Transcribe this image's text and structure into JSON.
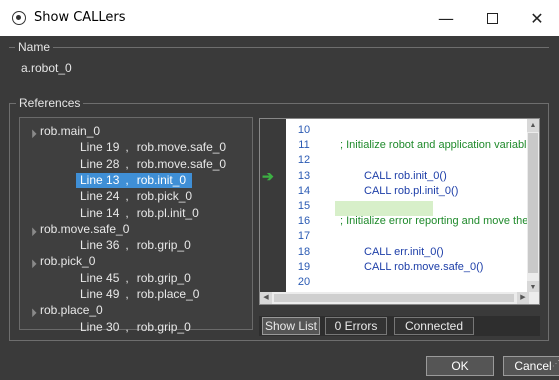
{
  "window": {
    "title": "Show CALLers",
    "minimize_label": "—",
    "close_label": "✕"
  },
  "name_group": {
    "label": "Name",
    "value": "a.robot_0"
  },
  "references": {
    "label": "References",
    "tree": [
      {
        "label": "rob.main_0",
        "children": [
          {
            "line": "Line 19",
            "target": "rob.move.safe_0",
            "selected": false
          },
          {
            "line": "Line 28",
            "target": "rob.move.safe_0",
            "selected": false
          },
          {
            "line": "Line 13",
            "target": "rob.init_0",
            "selected": true
          },
          {
            "line": "Line 24",
            "target": "rob.pick_0",
            "selected": false
          },
          {
            "line": "Line 14",
            "target": "rob.pl.init_0",
            "selected": false
          }
        ]
      },
      {
        "label": "rob.move.safe_0",
        "children": [
          {
            "line": "Line 36",
            "target": "rob.grip_0",
            "selected": false
          }
        ]
      },
      {
        "label": "rob.pick_0",
        "children": [
          {
            "line": "Line 45",
            "target": "rob.grip_0",
            "selected": false
          },
          {
            "line": "Line 49",
            "target": "rob.place_0",
            "selected": false
          }
        ]
      },
      {
        "label": "rob.place_0",
        "children": [
          {
            "line": "Line 30",
            "target": "rob.grip_0",
            "selected": false
          }
        ]
      }
    ],
    "separator": ","
  },
  "code": {
    "current_line": "13",
    "lines": [
      {
        "num": "10",
        "text": "",
        "kind": "plain"
      },
      {
        "num": "11",
        "text": "; Initialize robot and application variabl",
        "kind": "comment"
      },
      {
        "num": "12",
        "text": "",
        "kind": "plain"
      },
      {
        "num": "13",
        "text": "CALL rob.init_0()",
        "kind": "call"
      },
      {
        "num": "14",
        "text": "CALL rob.pl.init_0()",
        "kind": "call"
      },
      {
        "num": "15",
        "text": "",
        "kind": "plain"
      },
      {
        "num": "16",
        "text": "; Initialize error reporting and move the",
        "kind": "comment"
      },
      {
        "num": "17",
        "text": "",
        "kind": "plain"
      },
      {
        "num": "18",
        "text": "CALL err.init_0()",
        "kind": "call"
      },
      {
        "num": "19",
        "text": "CALL rob.move.safe_0()",
        "kind": "call"
      },
      {
        "num": "20",
        "text": "",
        "kind": "plain"
      }
    ],
    "colors": {
      "comment": "#1f8a2b",
      "call": "#1d3ea8",
      "line_number": "#2a5ab3",
      "highlight": "#d7efc9",
      "exec_arrow": "#3cb043"
    }
  },
  "status": {
    "show_list_label": "Show List",
    "errors_label": "0 Errors",
    "connection_label": "Connected"
  },
  "buttons": {
    "ok_label": "OK",
    "cancel_label": "Cancel"
  }
}
